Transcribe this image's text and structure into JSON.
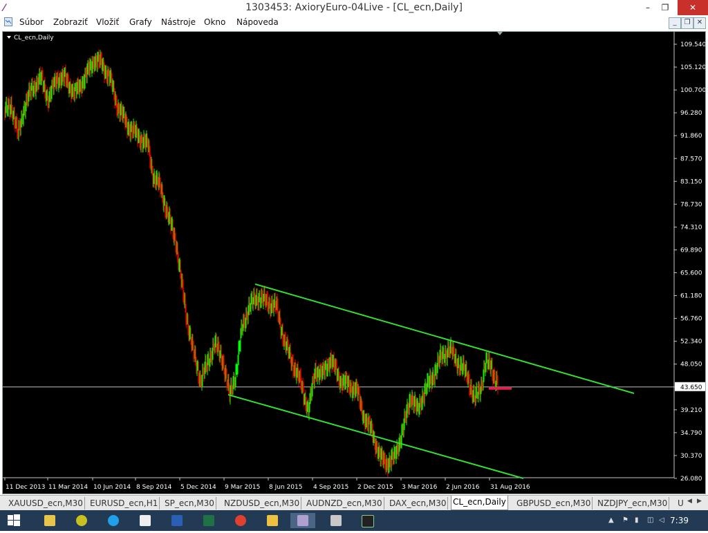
{
  "window": {
    "title": "1303453: AxioryEuro-04Live - [CL_ecn,Daily]",
    "app_icon": "⁄",
    "minimize": "–",
    "restore": "❐",
    "close": "✕"
  },
  "menu": {
    "items": [
      {
        "label": "Súbor"
      },
      {
        "label": "Zobraziť"
      },
      {
        "label": "Vložiť"
      },
      {
        "label": "Grafy"
      },
      {
        "label": "Nástroje"
      },
      {
        "label": "Okno"
      },
      {
        "label": "Nápoveda"
      }
    ],
    "mdi_minimize": "_",
    "mdi_restore": "❐",
    "mdi_close": "✕"
  },
  "chart": {
    "symbol_label": "CL_ecn,Daily",
    "y_axis_labels": [
      "109.540",
      "105.120",
      "100.700",
      "96.280",
      "91.860",
      "87.570",
      "83.150",
      "78.730",
      "74.310",
      "69.890",
      "65.600",
      "61.180",
      "56.760",
      "52.340",
      "48.050",
      "43.650",
      "39.210",
      "34.790",
      "30.370",
      "26.080"
    ],
    "current_price": "43.650",
    "x_axis_labels": [
      "11 Dec 2013",
      "11 Mar 2014",
      "10 Jun 2014",
      "8 Sep 2014",
      "5 Dec 2014",
      "9 Mar 2015",
      "8 Jun 2015",
      "4 Sep 2015",
      "2 Dec 2015",
      "3 Mar 2016",
      "2 Jun 2016",
      "31 Aug 2016"
    ],
    "colors": {
      "background": "#000000",
      "bull": "#00ff00",
      "bear": "#ff0000",
      "trendline": "#33dd33",
      "price_line": "#c0c0c0",
      "marker": "#e0204a"
    }
  },
  "tabs": [
    {
      "label": "XAUUSD_ecn,M30"
    },
    {
      "label": "EURUSD_ecn,H1"
    },
    {
      "label": "SP_ecn,M30"
    },
    {
      "label": "NZDUSD_ecn,M30"
    },
    {
      "label": "AUDNZD_ecn,M30"
    },
    {
      "label": "DAX_ecn,M30"
    },
    {
      "label": "CL_ecn,Daily",
      "active": true
    },
    {
      "label": "GBPUSD_ecn,M30"
    },
    {
      "label": "NZDJPY_ecn,M30"
    },
    {
      "label": "U"
    }
  ],
  "taskbar": {
    "clock": "7:39",
    "apps": [
      "windows-start",
      "folder",
      "metatrader",
      "skype",
      "crossed-app",
      "word",
      "excel",
      "chrome",
      "file-explorer",
      "axiory",
      "calculator",
      "chart-app"
    ]
  }
}
